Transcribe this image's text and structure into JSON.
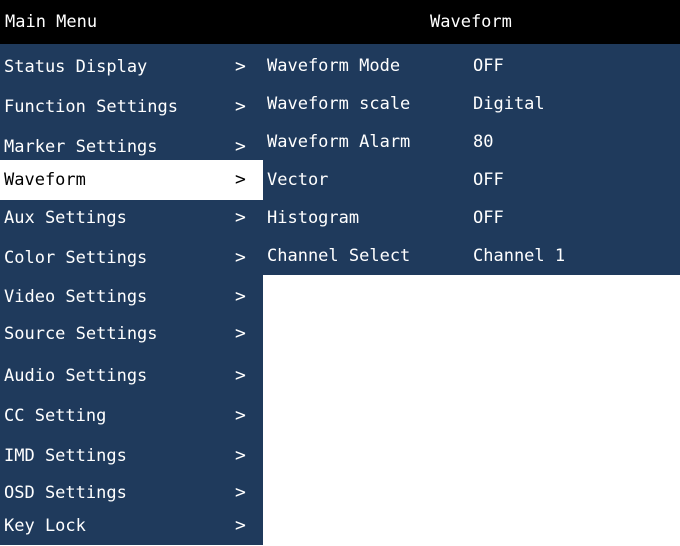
{
  "header": {
    "main_title": "Main Menu",
    "sub_title": "Waveform"
  },
  "menu": {
    "items": [
      {
        "label": "Status Display",
        "arrow": ">"
      },
      {
        "label": "Function Settings",
        "arrow": ">"
      },
      {
        "label": "Marker Settings",
        "arrow": ">"
      },
      {
        "label": "Waveform",
        "arrow": ">"
      },
      {
        "label": "Aux Settings",
        "arrow": ">"
      },
      {
        "label": "Color Settings",
        "arrow": ">"
      },
      {
        "label": "Video Settings",
        "arrow": ">"
      },
      {
        "label": "Source Settings",
        "arrow": ">"
      },
      {
        "label": "Audio Settings",
        "arrow": ">"
      },
      {
        "label": "CC Setting",
        "arrow": ">"
      },
      {
        "label": "IMD Settings",
        "arrow": ">"
      },
      {
        "label": "OSD Settings",
        "arrow": ">"
      },
      {
        "label": "Key Lock",
        "arrow": ">"
      }
    ],
    "selected": "Waveform"
  },
  "waveform": {
    "params": [
      {
        "label": "Waveform Mode",
        "value": "OFF"
      },
      {
        "label": "Waveform scale",
        "value": "Digital"
      },
      {
        "label": "Waveform Alarm",
        "value": "80"
      },
      {
        "label": "Vector",
        "value": "OFF"
      },
      {
        "label": "Histogram",
        "value": "OFF"
      },
      {
        "label": "Channel Select",
        "value": "Channel 1"
      }
    ]
  },
  "colors": {
    "panel_bg": "#1f3a5c",
    "title_bg": "#000000",
    "selected_bg": "#ffffff",
    "text": "#ffffff"
  }
}
